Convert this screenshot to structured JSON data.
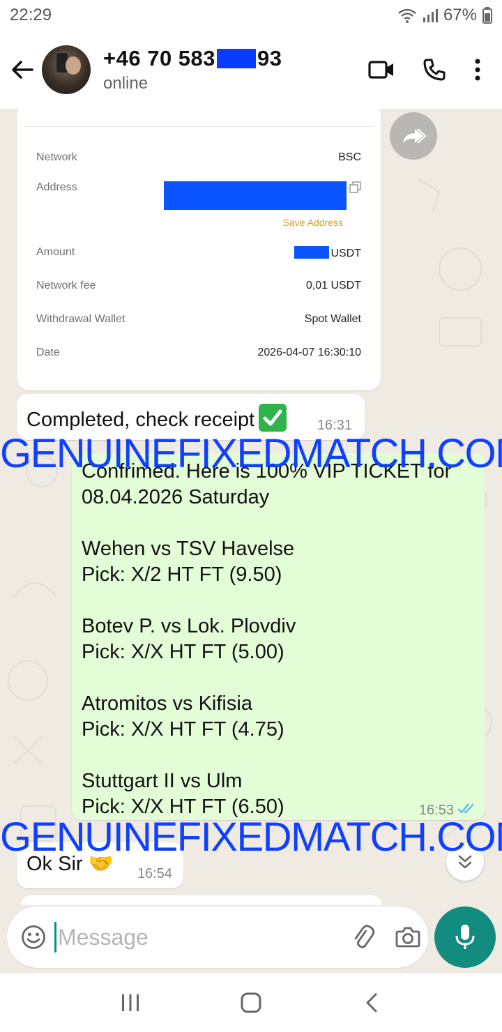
{
  "status_bar": {
    "time": "22:29",
    "battery": "67%"
  },
  "header": {
    "name_prefix": "+46 70 583",
    "name_suffix": "93",
    "status": "online"
  },
  "receipt": {
    "network_label": "Network",
    "network_value": "BSC",
    "address_label": "Address",
    "save_address": "Save Address",
    "amount_label": "Amount",
    "amount_unit": "USDT",
    "fee_label": "Network fee",
    "fee_value": "0,01 USDT",
    "wallet_label": "Withdrawal Wallet",
    "wallet_value": "Spot Wallet",
    "date_label": "Date",
    "date_value": "2026-04-07 16:30:10"
  },
  "messages": {
    "completed": {
      "text": "Completed, check receipt",
      "time": "16:31"
    },
    "ticket": {
      "lines": [
        "Confrimed. Here is 100% VIP TICKET for",
        "08.04.2026 Saturday",
        "Wehen vs TSV Havelse",
        "Pick: X/2 HT FT (9.50)",
        "Botev P. vs Lok. Plovdiv",
        "Pick: X/X HT FT (5.00)",
        "Atromitos vs Kifisia",
        "Pick: X/X HT FT (4.75)",
        "Stuttgart II vs Ulm",
        "Pick: X/X HT FT (6.50)"
      ],
      "time": "16:53"
    },
    "ok": {
      "text": "Ok Sir",
      "emoji": "🤝",
      "time": "16:54"
    }
  },
  "watermark": {
    "text": "GENUINEFIXEDMATCH.COM",
    "color": "#1040ff"
  },
  "input": {
    "placeholder": "Message"
  },
  "colors": {
    "accent": "#128c7e",
    "outgoing_bubble": "#e3fdd6",
    "chat_background": "#efeae2",
    "read_ticks": "#53bdeb"
  },
  "icons": [
    "back-arrow-icon",
    "video-call-icon",
    "phone-icon",
    "more-options-icon",
    "forward-icon",
    "copy-icon",
    "check-emoji-icon",
    "double-tick-icon",
    "scroll-down-icon",
    "emoji-icon",
    "attach-icon",
    "camera-icon",
    "mic-icon",
    "recents-nav-icon",
    "home-nav-icon",
    "back-nav-icon"
  ]
}
